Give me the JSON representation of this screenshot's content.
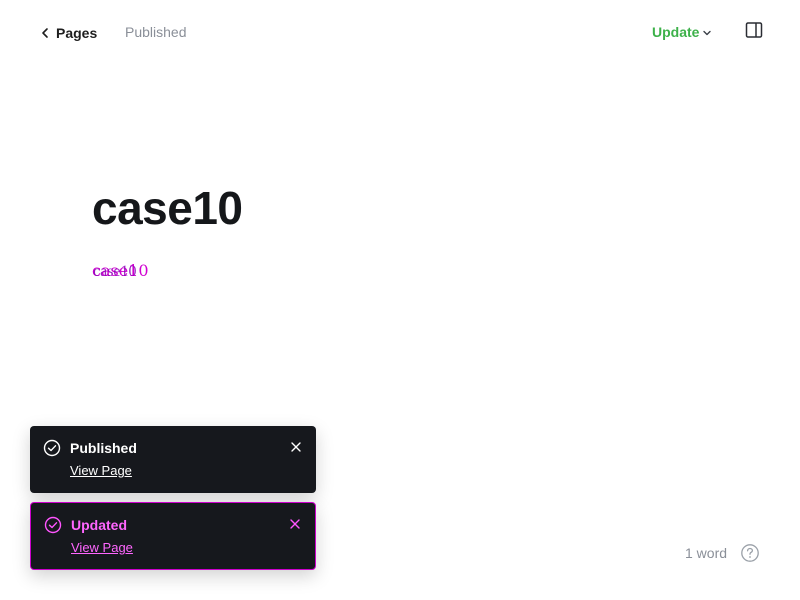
{
  "topbar": {
    "back_label": "Pages",
    "status": "Published",
    "update_label": "Update"
  },
  "editor": {
    "title": "case10",
    "body_text": "case10"
  },
  "toasts": [
    {
      "title": "Published",
      "link": "View Page"
    },
    {
      "title": "Updated",
      "link": "View Page"
    }
  ],
  "footer": {
    "word_count": "1 word"
  },
  "colors": {
    "accent_green": "#3db14a",
    "toast_bg": "#16181d",
    "highlight_magenta": "#cc00cc"
  },
  "icons": {
    "back": "chevron-left-icon",
    "update_menu": "chevron-down-icon",
    "panel": "sidebar-panel-icon",
    "toast_check": "check-circle-icon",
    "toast_close": "close-icon",
    "help": "question-circle-icon"
  }
}
